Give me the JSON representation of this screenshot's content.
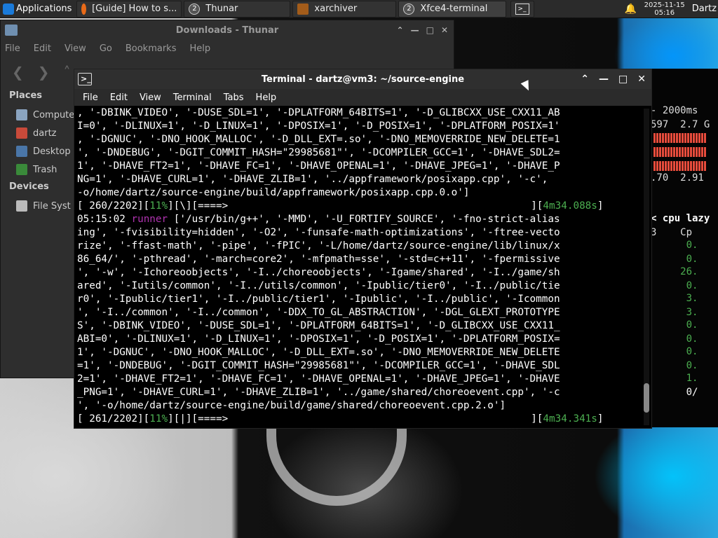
{
  "panel": {
    "applications_label": "Applications",
    "tasks": [
      {
        "label": "[Guide] How to s...",
        "icon": "firefox-icon"
      },
      {
        "label": "Thunar",
        "icon": "grouped-windows-icon",
        "badge": "2"
      },
      {
        "label": "xarchiver",
        "icon": "xarchiver-icon"
      },
      {
        "label": "Xfce4-terminal",
        "icon": "grouped-windows-icon",
        "badge": "2"
      }
    ],
    "clock_date": "2025-11-15",
    "clock_time": "05:16",
    "user": "Dartz"
  },
  "thunar": {
    "title": "Downloads - Thunar",
    "menu": [
      "File",
      "Edit",
      "View",
      "Go",
      "Bookmarks",
      "Help"
    ],
    "places_heading": "Places",
    "places": [
      "Compute",
      "dartz",
      "Desktop",
      "Trash"
    ],
    "devices_heading": "Devices",
    "devices": [
      "File Syst"
    ]
  },
  "htop": {
    "rows": [
      "- 2000ms",
      "597  2.7 G",
      "",
      "",
      "",
      ".70  2.91",
      "",
      "< cpu lazy",
      "3    Cp",
      "      0.",
      "      0.",
      "     26.",
      "      0.",
      "      3.",
      "      3.",
      "      0.",
      "      0.",
      "      0.",
      "      0.",
      "      1.",
      "      0/"
    ]
  },
  "terminal": {
    "title": "Terminal - dartz@vm3: ~/source-engine",
    "menu": [
      "File",
      "Edit",
      "View",
      "Terminal",
      "Tabs",
      "Help"
    ],
    "lines": [
      ", '-DBINK_VIDEO', '-DUSE_SDL=1', '-DPLATFORM_64BITS=1', '-D_GLIBCXX_USE_CXX11_AB",
      "I=0', '-DLINUX=1', '-D_LINUX=1', '-DPOSIX=1', '-D_POSIX=1', '-DPLATFORM_POSIX=1'",
      ", '-DGNUC', '-DNO_HOOK_MALLOC', '-D_DLL_EXT=.so', '-DNO_MEMOVERRIDE_NEW_DELETE=1",
      "', '-DNDEBUG', '-DGIT_COMMIT_HASH=\"29985681\"', '-DCOMPILER_GCC=1', '-DHAVE_SDL2=",
      "1', '-DHAVE_FT2=1', '-DHAVE_FC=1', '-DHAVE_OPENAL=1', '-DHAVE_JPEG=1', '-DHAVE_P",
      "NG=1', '-DHAVE_CURL=1', '-DHAVE_ZLIB=1', '../appframework/posixapp.cpp', '-c',",
      "-o/home/dartz/source-engine/build/appframework/posixapp.cpp.0.o']"
    ],
    "progress1": {
      "prefix": "[ 260/2202][",
      "pct": "11%",
      "mid": "][\\][====>",
      "tail_open": "][",
      "time": "4m34.088s",
      "tail_close": "]"
    },
    "runner_line": {
      "time": "05:15:02",
      "word": "runner",
      "rest": " ['/usr/bin/g++', '-MMD', '-U_FORTIFY_SOURCE', '-fno-strict-alias"
    },
    "lines2": [
      "ing', '-fvisibility=hidden', '-O2', '-funsafe-math-optimizations', '-ftree-vecto",
      "rize', '-ffast-math', '-pipe', '-fPIC', '-L/home/dartz/source-engine/lib/linux/x",
      "86_64/', '-pthread', '-march=core2', '-mfpmath=sse', '-std=c++11', '-fpermissive",
      "', '-w', '-Ichoreoobjects', '-I../choreoobjects', '-Igame/shared', '-I../game/sh",
      "ared', '-Iutils/common', '-I../utils/common', '-Ipublic/tier0', '-I../public/tie",
      "r0', '-Ipublic/tier1', '-I../public/tier1', '-Ipublic', '-I../public', '-Icommon",
      "', '-I../common', '-I../common', '-DDX_TO_GL_ABSTRACTION', '-DGL_GLEXT_PROTOTYPE",
      "S', '-DBINK_VIDEO', '-DUSE_SDL=1', '-DPLATFORM_64BITS=1', '-D_GLIBCXX_USE_CXX11_",
      "ABI=0', '-DLINUX=1', '-D_LINUX=1', '-DPOSIX=1', '-D_POSIX=1', '-DPLATFORM_POSIX=",
      "1', '-DGNUC', '-DNO_HOOK_MALLOC', '-D_DLL_EXT=.so', '-DNO_MEMOVERRIDE_NEW_DELETE",
      "=1', '-DNDEBUG', '-DGIT_COMMIT_HASH=\"29985681\"', '-DCOMPILER_GCC=1', '-DHAVE_SDL",
      "2=1', '-DHAVE_FT2=1', '-DHAVE_FC=1', '-DHAVE_OPENAL=1', '-DHAVE_JPEG=1', '-DHAVE",
      "_PNG=1', '-DHAVE_CURL=1', '-DHAVE_ZLIB=1', '../game/shared/choreoevent.cpp', '-c",
      "', '-o/home/dartz/source-engine/build/game/shared/choreoevent.cpp.2.o']"
    ],
    "progress2": {
      "prefix": "[ 261/2202][",
      "pct": "11%",
      "mid": "][|][====>",
      "tail_open": "][",
      "time": "4m34.341s",
      "tail_close": "]"
    }
  }
}
